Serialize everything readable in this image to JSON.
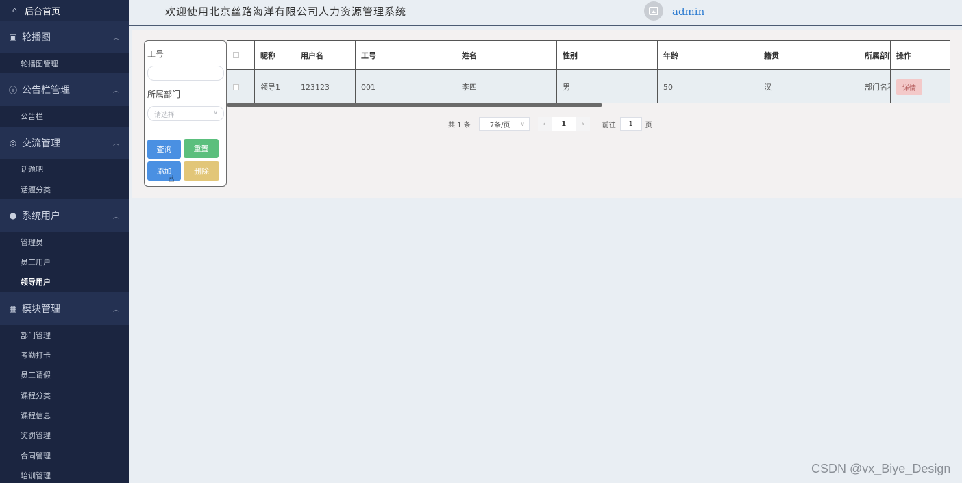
{
  "sidebar": {
    "home": "后台首页",
    "groups": [
      {
        "title": "轮播图",
        "icon": "image-icon",
        "items": [
          {
            "label": "轮播图管理"
          }
        ]
      },
      {
        "title": "公告栏管理",
        "icon": "info-circle-icon",
        "items": [
          {
            "label": "公告栏"
          }
        ]
      },
      {
        "title": "交流管理",
        "icon": "chat-icon",
        "items": [
          {
            "label": "话题吧"
          },
          {
            "label": "话题分类"
          }
        ]
      },
      {
        "title": "系统用户",
        "icon": "user-icon",
        "items": [
          {
            "label": "管理员"
          },
          {
            "label": "员工用户"
          },
          {
            "label": "领导用户",
            "active": true
          }
        ]
      },
      {
        "title": "模块管理",
        "icon": "grid-icon",
        "items": [
          {
            "label": "部门管理"
          },
          {
            "label": "考勤打卡"
          },
          {
            "label": "员工请假"
          },
          {
            "label": "课程分类"
          },
          {
            "label": "课程信息"
          },
          {
            "label": "奖罚管理"
          },
          {
            "label": "合同管理"
          },
          {
            "label": "培训管理"
          }
        ]
      }
    ]
  },
  "header": {
    "title": "欢迎使用北京丝路海洋有限公司人力资源管理系统",
    "username": "admin"
  },
  "filter": {
    "label_id": "工号",
    "id_value": "",
    "label_dept": "所属部门",
    "dept_placeholder": "请选择",
    "query": "查询",
    "reset": "重置",
    "add": "添加",
    "delete": "删除"
  },
  "table": {
    "headers": [
      "昵称",
      "用户名",
      "工号",
      "姓名",
      "性别",
      "年龄",
      "籍贯",
      "所属部门",
      "操作"
    ],
    "rows": [
      {
        "cells": [
          "领导1",
          "123123",
          "001",
          "李四",
          "男",
          "50",
          "汉",
          "部门名称"
        ],
        "action": "详情"
      }
    ]
  },
  "pagination": {
    "total": "共 1 条",
    "page_size": "7条/页",
    "current_page": "1",
    "goto_label": "前往",
    "goto_value": "1",
    "page_suffix": "页"
  },
  "watermark": "CSDN @vx_Biye_Design"
}
